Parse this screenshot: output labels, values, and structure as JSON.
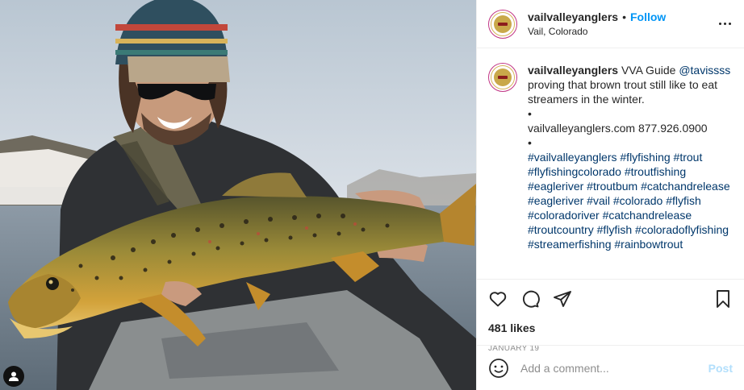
{
  "post": {
    "username": "vailvalleyanglers",
    "follow_label": "Follow",
    "separator": "•",
    "location": "Vail, Colorado",
    "more_icon": "more-horizontal-icon"
  },
  "caption": {
    "username": "vailvalleyanglers",
    "text_intro": "VVA Guide ",
    "mention": "@tavissss",
    "text_body": "proving that brown trout still like to eat streamers in the winter.",
    "bullet1": "•",
    "contact": "vailvalleyanglers.com 877.926.0900",
    "bullet2": "•",
    "hashtags": "#vailvalleyanglers #flyfishing #trout #flyfishingcolorado #troutfishing #eagleriver #troutbum #catchandrelease #eagleriver #vail #colorado #flyfish #coloradoriver #catchandrelease #troutcountry #flyfish #coloradoflyfishing #streamerfishing #rainbowtrout"
  },
  "actions": {
    "icons": [
      "heart-icon",
      "comment-icon",
      "share-icon",
      "bookmark-icon"
    ],
    "likes": "481 likes",
    "date": "JANUARY 19"
  },
  "comment_box": {
    "placeholder": "Add a comment...",
    "post_label": "Post"
  },
  "colors": {
    "link": "#00376b",
    "follow": "#0095f6",
    "post_disabled": "#b2dffc",
    "muted": "#8e8e8e"
  }
}
